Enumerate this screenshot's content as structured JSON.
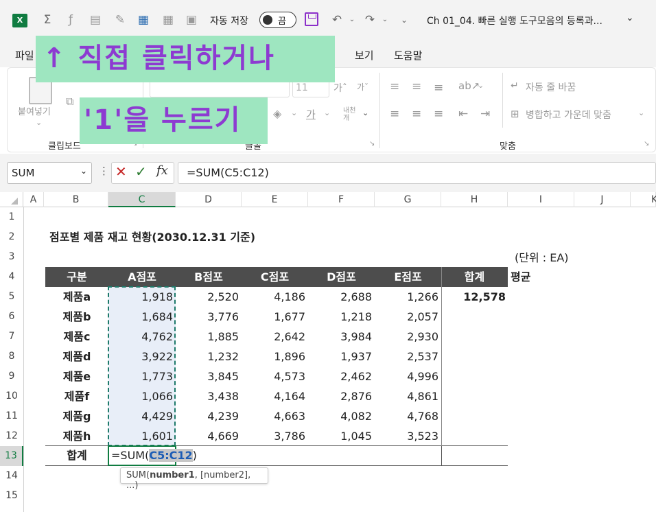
{
  "titlebar": {
    "autosave_label": "자동 저장",
    "autosave_state": "끔",
    "doc_title": "Ch 01_04. 빠른 실행 도구모음의 등록과..."
  },
  "menu": [
    "파일",
    "보기",
    "도움말"
  ],
  "ribbon": {
    "paste_label": "붙여넣기",
    "clipboard_group": "클립보드",
    "font_group": "글꼴",
    "align_group": "맞춤",
    "font_size": "11",
    "wrap_text": "자동 줄 바꿈",
    "merge_center": "병합하고 가운데 맞춤"
  },
  "overlay": {
    "line1": "↑ 직접 클릭하거나",
    "line2": "'1'을 누르기"
  },
  "formula_bar": {
    "name_box": "SUM",
    "formula": "=SUM(C5:C12)"
  },
  "columns": [
    "A",
    "B",
    "C",
    "D",
    "E",
    "F",
    "G",
    "H",
    "I",
    "J",
    "K"
  ],
  "rows": [
    "1",
    "2",
    "3",
    "4",
    "5",
    "6",
    "7",
    "8",
    "9",
    "10",
    "11",
    "12",
    "13",
    "14",
    "15"
  ],
  "sheet": {
    "title": "점포별 제품 재고 현황(2030.12.31 기준)",
    "unit": "(단위 : EA)",
    "headers": [
      "구분",
      "A점포",
      "B점포",
      "C점포",
      "D점포",
      "E점포",
      "합계"
    ],
    "avg_header": "평균",
    "data": [
      {
        "label": "제품a",
        "values": [
          "1,918",
          "2,520",
          "4,186",
          "2,688",
          "1,266"
        ],
        "total": "12,578"
      },
      {
        "label": "제품b",
        "values": [
          "1,684",
          "3,776",
          "1,677",
          "1,218",
          "2,057"
        ],
        "total": ""
      },
      {
        "label": "제품c",
        "values": [
          "4,762",
          "1,885",
          "2,642",
          "3,984",
          "2,930"
        ],
        "total": ""
      },
      {
        "label": "제품d",
        "values": [
          "3,922",
          "1,232",
          "1,896",
          "1,937",
          "2,537"
        ],
        "total": ""
      },
      {
        "label": "제품e",
        "values": [
          "1,773",
          "3,845",
          "4,573",
          "2,462",
          "4,996"
        ],
        "total": ""
      },
      {
        "label": "제품f",
        "values": [
          "1,066",
          "3,438",
          "4,164",
          "2,876",
          "4,861"
        ],
        "total": ""
      },
      {
        "label": "제품g",
        "values": [
          "4,429",
          "4,239",
          "4,663",
          "4,082",
          "4,768"
        ],
        "total": ""
      },
      {
        "label": "제품h",
        "values": [
          "1,601",
          "4,669",
          "3,786",
          "1,045",
          "3,523"
        ],
        "total": ""
      }
    ],
    "total_label": "합계",
    "editing_prefix": "=SUM(",
    "editing_ref": "C5:C12",
    "editing_suffix": ")",
    "tooltip_fn": "SUM(",
    "tooltip_arg1": "number1",
    "tooltip_rest": ", [number2], ...)"
  },
  "colors": {
    "accent_purple": "#8d3bd1",
    "banner_green": "#9ee6c0",
    "excel_green": "#107c41",
    "header_dark": "#4d4d4d"
  }
}
